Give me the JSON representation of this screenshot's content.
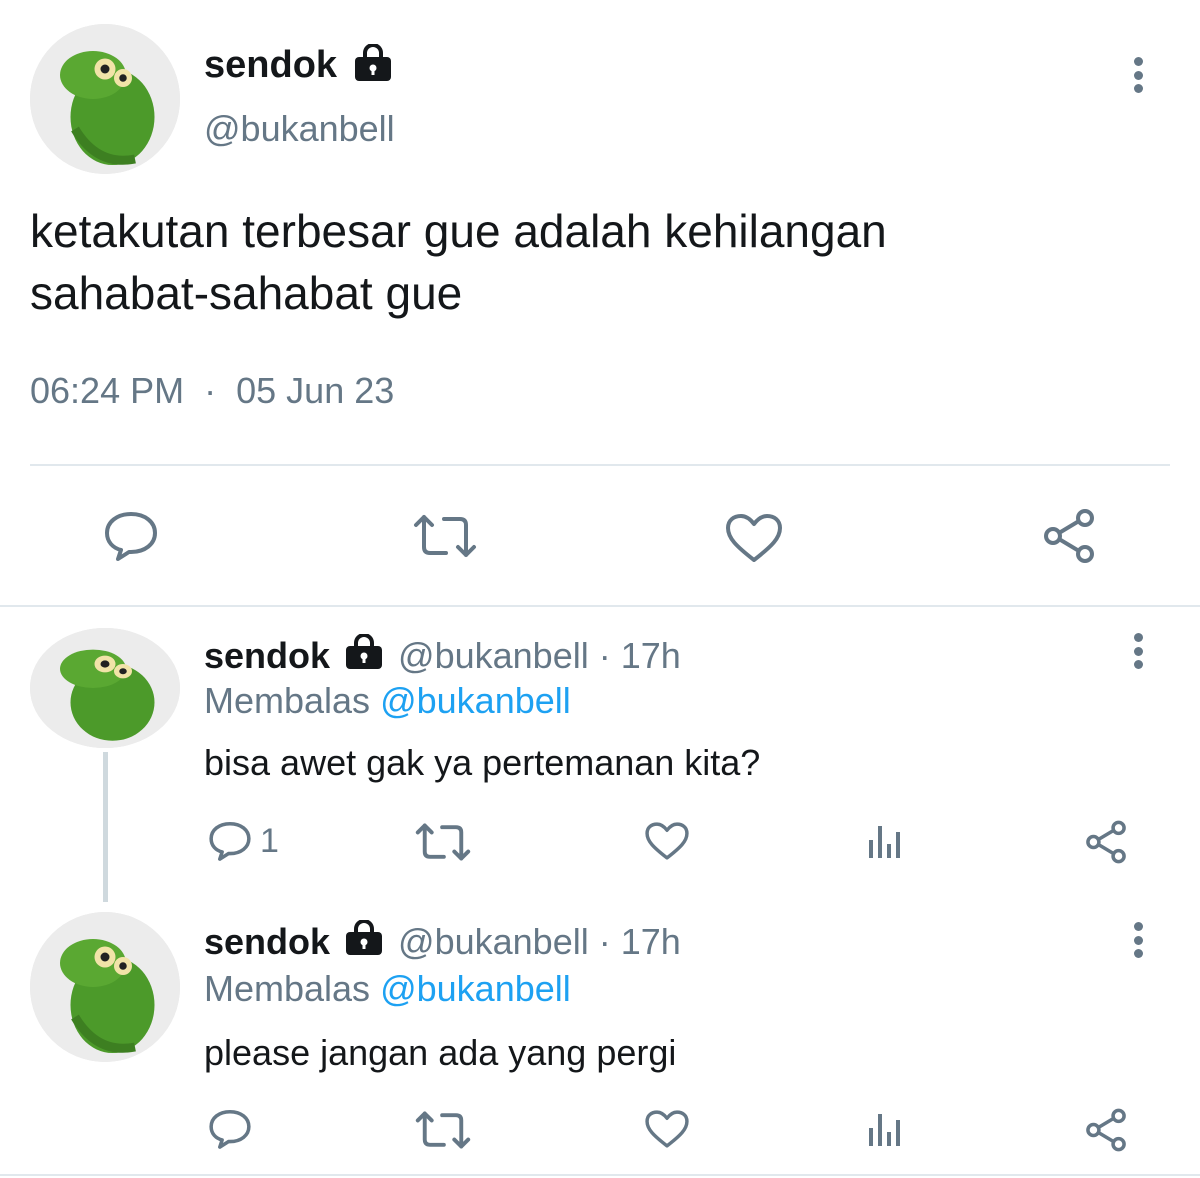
{
  "main_tweet": {
    "author_name": "sendok",
    "handle": "@bukanbell",
    "text_line1": "ketakutan terbesar gue adalah kehilangan",
    "text_line2": "sahabat-sahabat gue",
    "time": "06:24 PM",
    "date_separator": "·",
    "date": "05 Jun 23"
  },
  "replies": [
    {
      "author_name": "sendok",
      "handle": "@bukanbell",
      "age": "· 17h",
      "replying_prefix": "Membalas",
      "replying_to": "@bukanbell",
      "text": "bisa awet gak ya pertemanan kita?",
      "reply_count": "1"
    },
    {
      "author_name": "sendok",
      "handle": "@bukanbell",
      "age": "· 17h",
      "replying_prefix": "Membalas",
      "replying_to": "@bukanbell",
      "text": "please jangan ada yang pergi",
      "reply_count": ""
    }
  ],
  "icons": {
    "lock": "lock-icon",
    "more": "more-vertical-icon",
    "reply": "reply-bubble-icon",
    "retweet": "retweet-icon",
    "like": "heart-icon",
    "analytics": "analytics-bars-icon",
    "share": "share-icon"
  },
  "colors": {
    "text": "#14171a",
    "muted": "#657786",
    "link": "#1da1f2",
    "avatar_green": "#4c9a2a"
  }
}
